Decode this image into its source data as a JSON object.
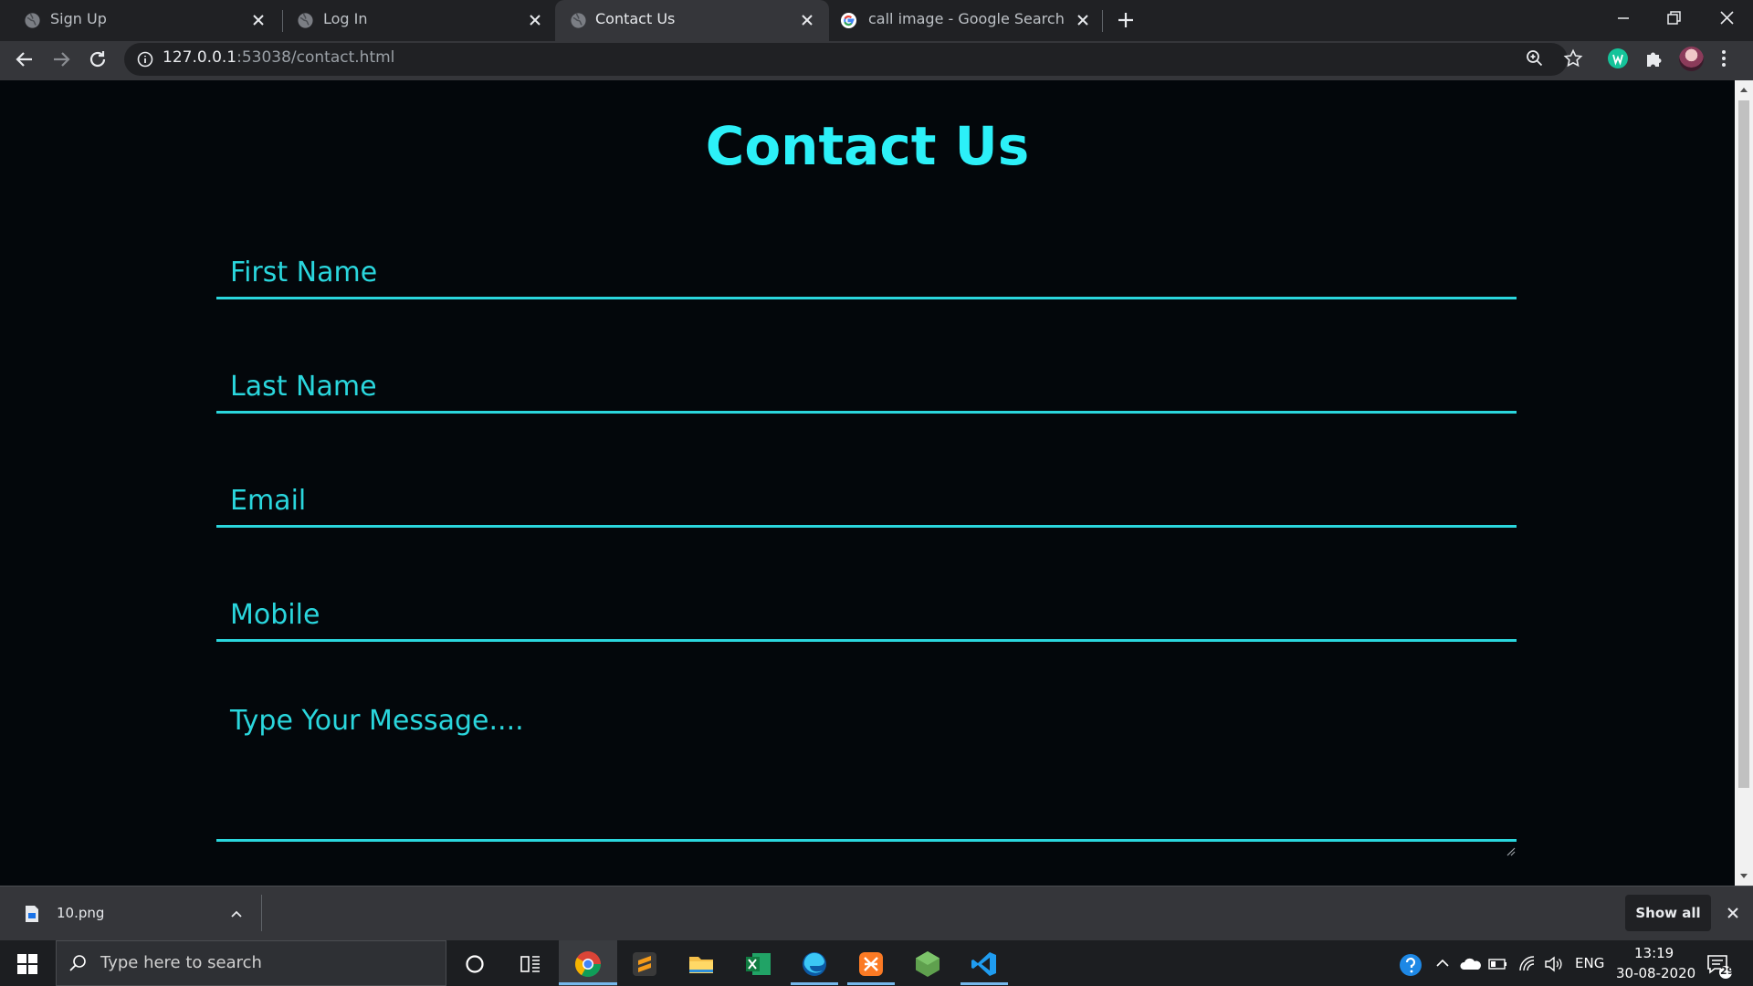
{
  "browser": {
    "tabs": [
      {
        "label": "Sign Up",
        "active": false,
        "icon": "globe-icon"
      },
      {
        "label": "Log In",
        "active": false,
        "icon": "globe-icon"
      },
      {
        "label": "Contact Us",
        "active": true,
        "icon": "globe-icon"
      },
      {
        "label": "call image - Google Search",
        "active": false,
        "icon": "google-icon"
      }
    ],
    "url_host": "127.0.0.1",
    "url_rest": ":53038/contact.html"
  },
  "page": {
    "title": "Contact Us",
    "fields": {
      "first_name_placeholder": "First Name",
      "last_name_placeholder": "Last Name",
      "email_placeholder": "Email",
      "mobile_placeholder": "Mobile",
      "message_placeholder": "Type Your Message...."
    }
  },
  "downloads": {
    "file_name": "10.png",
    "show_all_label": "Show all"
  },
  "taskbar": {
    "search_placeholder": "Type here to search",
    "language": "ENG",
    "time": "13:19",
    "date": "30-08-2020",
    "notification_count": "29"
  },
  "colors": {
    "accent": "#2cf0f8",
    "page_background": "#03070b",
    "browser_frame": "#35363a"
  }
}
